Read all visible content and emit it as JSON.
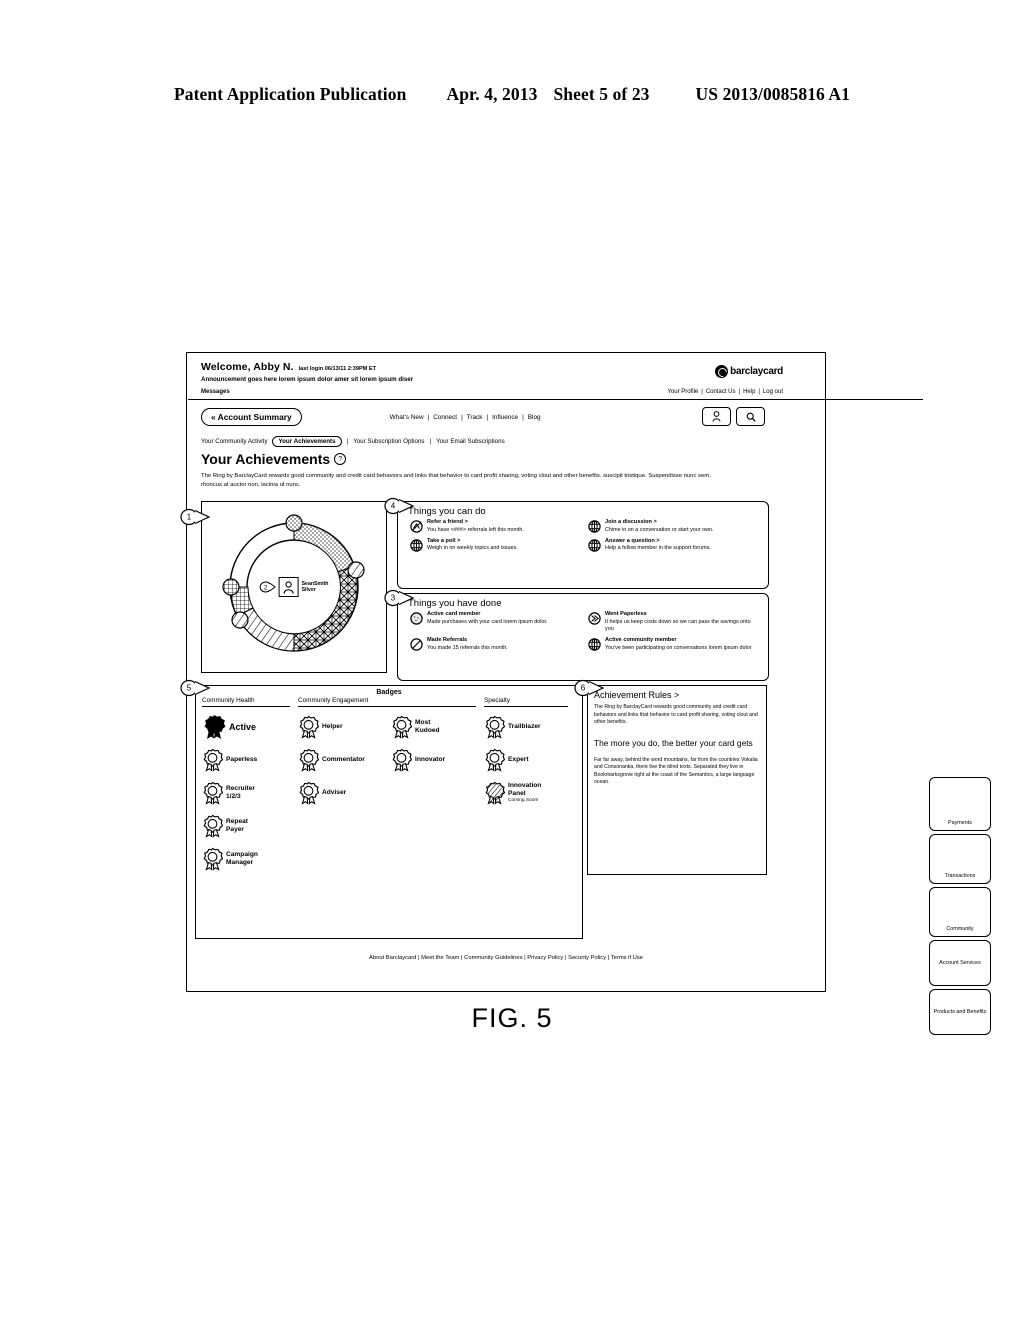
{
  "patent_header": {
    "publication": "Patent Application Publication",
    "date": "Apr. 4, 2013",
    "sheet": "Sheet 5 of 23",
    "number": "US 2013/0085816 A1"
  },
  "figure": {
    "caption": "FIG. 5"
  },
  "callouts": [
    {
      "id": "1",
      "label": "1"
    },
    {
      "id": "2",
      "label": "2"
    },
    {
      "id": "3",
      "label": "3"
    },
    {
      "id": "4",
      "label": "4"
    },
    {
      "id": "5",
      "label": "5"
    },
    {
      "id": "6",
      "label": "6"
    }
  ],
  "header": {
    "welcome": "Welcome, Abby N.",
    "last_login": "last login 06/13/11 2:39PM ET",
    "announcement": "Announcement goes here lorem ipsum dolor amer sit lorem ipsum diser",
    "messages": "Messages",
    "brand": "barclaycard",
    "top_links": [
      "Your Profile",
      "Contact Us",
      "Help",
      "Log out"
    ],
    "separator": "|"
  },
  "nav": {
    "account_summary": "« Account Summary",
    "main_links": [
      "What's New",
      "Connect",
      "Track",
      "Influence",
      "Blog"
    ],
    "separator": "|",
    "profile_icon": "user-icon",
    "search_icon": "search-icon"
  },
  "subnav": {
    "items": [
      "Your Community Activity",
      "Your Achievements",
      "Your Subscription Options",
      "Your Email Subscriptions"
    ],
    "active": "Your Achievements",
    "separator": "|"
  },
  "page": {
    "title": "Your Achievements",
    "help_icon": "question-mark-icon",
    "intro": "The Ring by BarclayCard rewards good community and credit card behaviors and links that behavior to card profit sharing, voting clout and other benefits. suscipit tristique. Suspendisse nunc sem, rhoncus at auctor non, lacinia ut nunc."
  },
  "ring": {
    "member_name": "SeanSmith",
    "tier": "Silver",
    "avatar_icon": "user-avatar-icon",
    "segments": [
      {
        "name": "blank",
        "pattern": "none",
        "from": -90,
        "to": 0
      },
      {
        "name": "dotted",
        "pattern": "dots",
        "from": 0,
        "to": 72
      },
      {
        "name": "basketweave",
        "pattern": "weave",
        "from": 72,
        "to": 150
      },
      {
        "name": "diagonal",
        "pattern": "diagonal",
        "from": 150,
        "to": 215
      },
      {
        "name": "crosshatch",
        "pattern": "grid",
        "from": 215,
        "to": 270
      }
    ],
    "markers": 4
  },
  "things_can_do": {
    "title": "Things you can do",
    "items": [
      {
        "icon": "referral-icon",
        "title": "Refer a friend >",
        "body": "You have <###> referrals left this month."
      },
      {
        "icon": "globe-icon",
        "title": "Join a discussion >",
        "body": "Chime in on a conversation or start your own."
      },
      {
        "icon": "globe-icon",
        "title": "Take a poll >",
        "body": "Weigh in on weekly topics and issues."
      },
      {
        "icon": "globe-icon",
        "title": "Answer a question >",
        "body": "Help a fellow member in the support forums."
      }
    ]
  },
  "things_done": {
    "title": "Things you have done",
    "items": [
      {
        "icon": "dotted-circle-icon",
        "title": "Active card member",
        "body": "Made purchases with your card lorem ipsum dolor."
      },
      {
        "icon": "chevron-circle-icon",
        "title": "Went Paperless",
        "body": "It helps us keep costs down so we can pass the savings onto you"
      },
      {
        "icon": "slash-circle-icon",
        "title": "Made Referrals",
        "body": "You made 15 referrals this month."
      },
      {
        "icon": "globe-icon",
        "title": "Active community member",
        "body": "You've been participating on conversations lorem ipsum dolor"
      }
    ]
  },
  "badges": {
    "heading": "Badges",
    "columns": [
      {
        "header": "Community Health"
      },
      {
        "header": "Community Engagement"
      },
      {
        "header": "Specialty"
      }
    ],
    "community_health": [
      {
        "label": "Active",
        "icon": "ribbon-filled-icon",
        "state": "earned"
      },
      {
        "label": "Paperless",
        "icon": "ribbon-icon",
        "state": "locked"
      },
      {
        "label": "Recruiter",
        "sub": "1/2/3",
        "icon": "ribbon-icon",
        "state": "locked"
      },
      {
        "label": "Repeat",
        "sub": "Payer",
        "icon": "ribbon-icon",
        "state": "locked"
      },
      {
        "label": "Campaign",
        "sub": "Manager",
        "icon": "ribbon-icon",
        "state": "locked"
      }
    ],
    "community_engagement_a": [
      {
        "label": "Helper",
        "icon": "ribbon-icon"
      },
      {
        "label": "Commentator",
        "icon": "ribbon-icon"
      },
      {
        "label": "Adviser",
        "icon": "ribbon-icon"
      }
    ],
    "community_engagement_b": [
      {
        "label": "Most",
        "sub": "Kudoed",
        "icon": "ribbon-icon"
      },
      {
        "label": "Innovator",
        "icon": "ribbon-icon"
      }
    ],
    "specialty": [
      {
        "label": "Trailblazer",
        "icon": "ribbon-icon"
      },
      {
        "label": "Expert",
        "icon": "ribbon-icon"
      },
      {
        "label": "Innovation",
        "sub": "Panel",
        "note": "Coming Soon!",
        "icon": "ribbon-hatched-icon"
      }
    ]
  },
  "rules": {
    "title": "Achievement Rules >",
    "paragraph1": "The Ring by BarclayCard rewards good community and credit card behaviors and links that behavior to card profit sharing, voting clout and other benefits.",
    "subhead": "The more you do, the better your card gets",
    "paragraph2": "Far far away, behind the word mountains, far from the countries Vokalia and Consonantia, there live the blind texts. Separated they live in Bookmarksgrove right at the coast of the Semantics, a large language ocean."
  },
  "sidebar": {
    "tabs": [
      "Payments",
      "Transactions",
      "Community",
      "Account Services",
      "Products and Benefits"
    ]
  },
  "footer": {
    "links": [
      "About Barclaycard",
      "Meet the Team",
      "Community Guidelines",
      "Privacy Policy",
      "Security Policy",
      "Terms if Use"
    ],
    "separator": "|"
  }
}
